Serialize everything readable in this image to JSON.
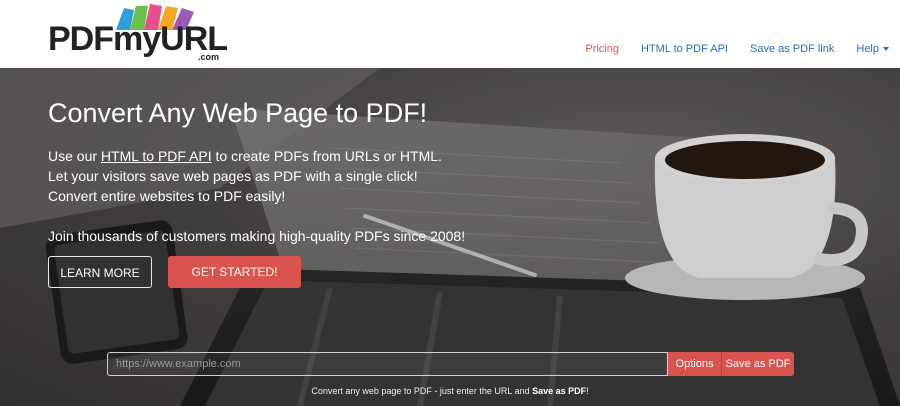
{
  "header": {
    "logo_text": "PDFmyURL",
    "logo_suffix": ".com",
    "nav": {
      "pricing": "Pricing",
      "api": "HTML to PDF API",
      "save_link": "Save as PDF link",
      "help": "Help"
    },
    "colors": {
      "nav_link": "#2a6db5",
      "nav_active": "#d9534f"
    }
  },
  "hero": {
    "title": "Convert Any Web Page to PDF!",
    "line1_pre": "Use our ",
    "line1_link": "HTML to PDF API",
    "line1_post": " to create PDFs from URLs or HTML.",
    "line2": "Let your visitors save web pages as PDF with a single click!",
    "line3": "Convert entire websites to PDF easily!",
    "join": "Join thousands of customers making high-quality PDFs since 2008!",
    "learn_more": "LEARN MORE",
    "get_started": "GET STARTED!",
    "accent_color": "#d9534f"
  },
  "converter": {
    "url_placeholder": "https://www.example.com",
    "options_label": "Options",
    "save_label": "Save as PDF",
    "hint_pre": "Convert any web page to PDF - just enter the URL and ",
    "hint_bold": "Save as PDF",
    "hint_post": "!"
  }
}
